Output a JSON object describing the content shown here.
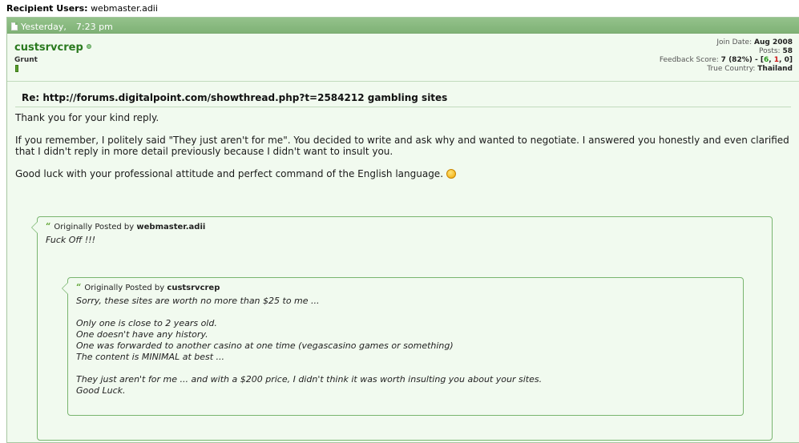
{
  "recipient": {
    "label": "Recipient Users:",
    "value": "webmaster.adii"
  },
  "post": {
    "date": "Yesterday,",
    "time": "7:23 pm",
    "user": {
      "name": "custsrvcrep",
      "title": "Grunt"
    },
    "stats": {
      "join_date_label": "Join Date:",
      "join_date": "Aug 2008",
      "posts_label": "Posts:",
      "posts": "58",
      "feedback_label": "Feedback Score:",
      "feedback_score": "7 (82%) - [",
      "feedback_pos": "6",
      "feedback_sep1": ", ",
      "feedback_neu": "1",
      "feedback_sep2": ", ",
      "feedback_neg": "0",
      "feedback_end": "]",
      "country_label": "True Country:",
      "country": "Thailand"
    },
    "title": "Re: http://forums.digitalpoint.com/showthread.php?t=2584212 gambling sites",
    "message": {
      "p1": "Thank you for your kind reply.",
      "p2": "If you remember, I politely said \"They just aren't for me\". You decided to write and ask why and wanted to negotiate. I answered you honestly and even clarified that I didn't reply in more detail previously because I didn't want to insult you.",
      "p3": "Good luck with your professional attitude and perfect command of the English language."
    },
    "quote_outer": {
      "prefix": "Originally Posted by",
      "author": "webmaster.adii",
      "text": "Fuck Off !!!"
    },
    "quote_inner": {
      "prefix": "Originally Posted by",
      "author": "custsrvcrep",
      "lines": [
        "Sorry, these sites are worth no more than $25 to me ...",
        "Only one is close to 2 years old.",
        "One doesn't have any history.",
        "One was forwarded to another casino at one time (vegascasino games or something)",
        "The content is MINIMAL at best ...",
        "They just aren't for me ... and with a $200 price, I didn't think it was worth insulting you about your sites.",
        "Good Luck."
      ]
    }
  }
}
